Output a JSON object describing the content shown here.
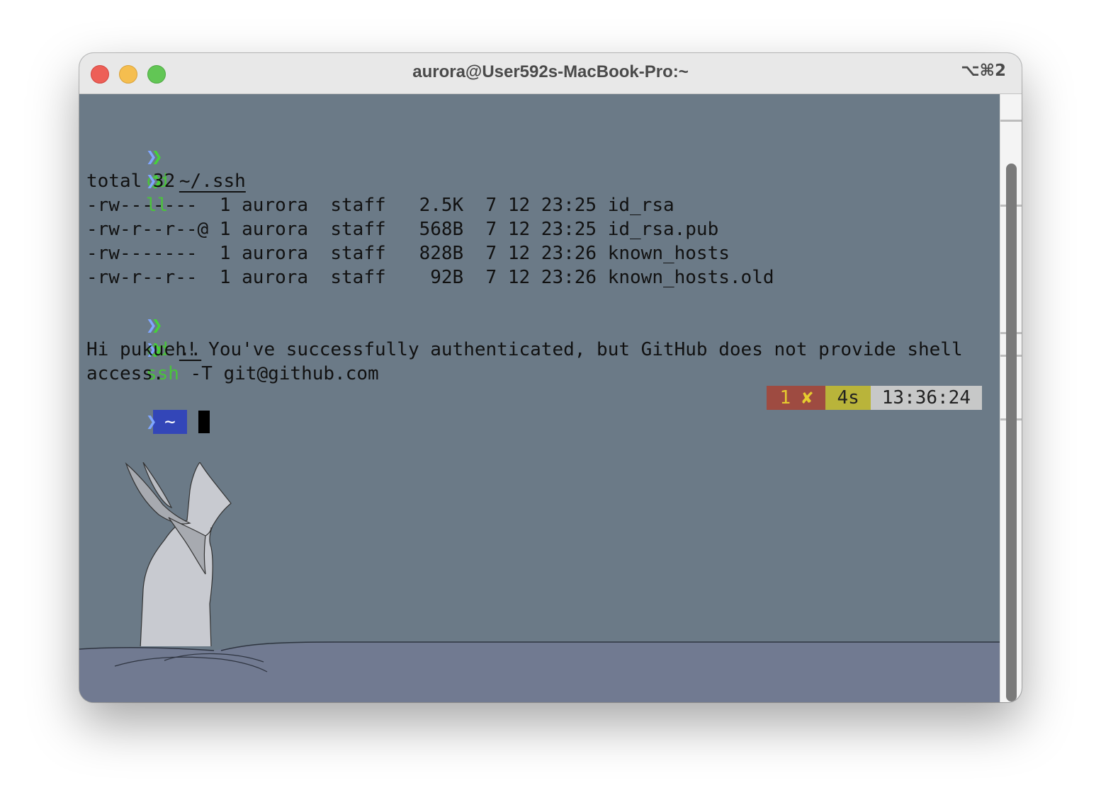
{
  "window": {
    "title": "aurora@User592s-MacBook-Pro:~",
    "shortcut": "⌥⌘2"
  },
  "terminal": {
    "prompt_icon": "chevron-prompt-icon",
    "cmd1": {
      "command": "cd",
      "argument": "~/.ssh"
    },
    "cmd2": {
      "command": "ll"
    },
    "listing_total": "total 32",
    "listing": [
      "-rw-------  1 aurora  staff   2.5K  7 12 23:25 id_rsa",
      "-rw-r--r--@ 1 aurora  staff   568B  7 12 23:25 id_rsa.pub",
      "-rw-------  1 aurora  staff   828B  7 12 23:26 known_hosts",
      "-rw-r--r--  1 aurora  staff    92B  7 12 23:26 known_hosts.old"
    ],
    "cmd3": {
      "command": "cd",
      "argument": ".."
    },
    "cmd4": {
      "command": "ssh",
      "rest": " -T git@github.com"
    },
    "ssh_output": [
      "Hi pukueh! You've successfully authenticated, but GitHub does not provide shell",
      "access."
    ],
    "current_dir": "~",
    "status": {
      "exit_code": "1 ✘",
      "duration": "4s",
      "time": "13:36:24"
    }
  },
  "colors": {
    "background": "#6b7a87",
    "command": "#4ac53a",
    "dir_segment": "#3346b8",
    "error_segment": "#9e4b41",
    "duration_segment": "#b9b43a",
    "time_segment": "#c7c8c8"
  }
}
